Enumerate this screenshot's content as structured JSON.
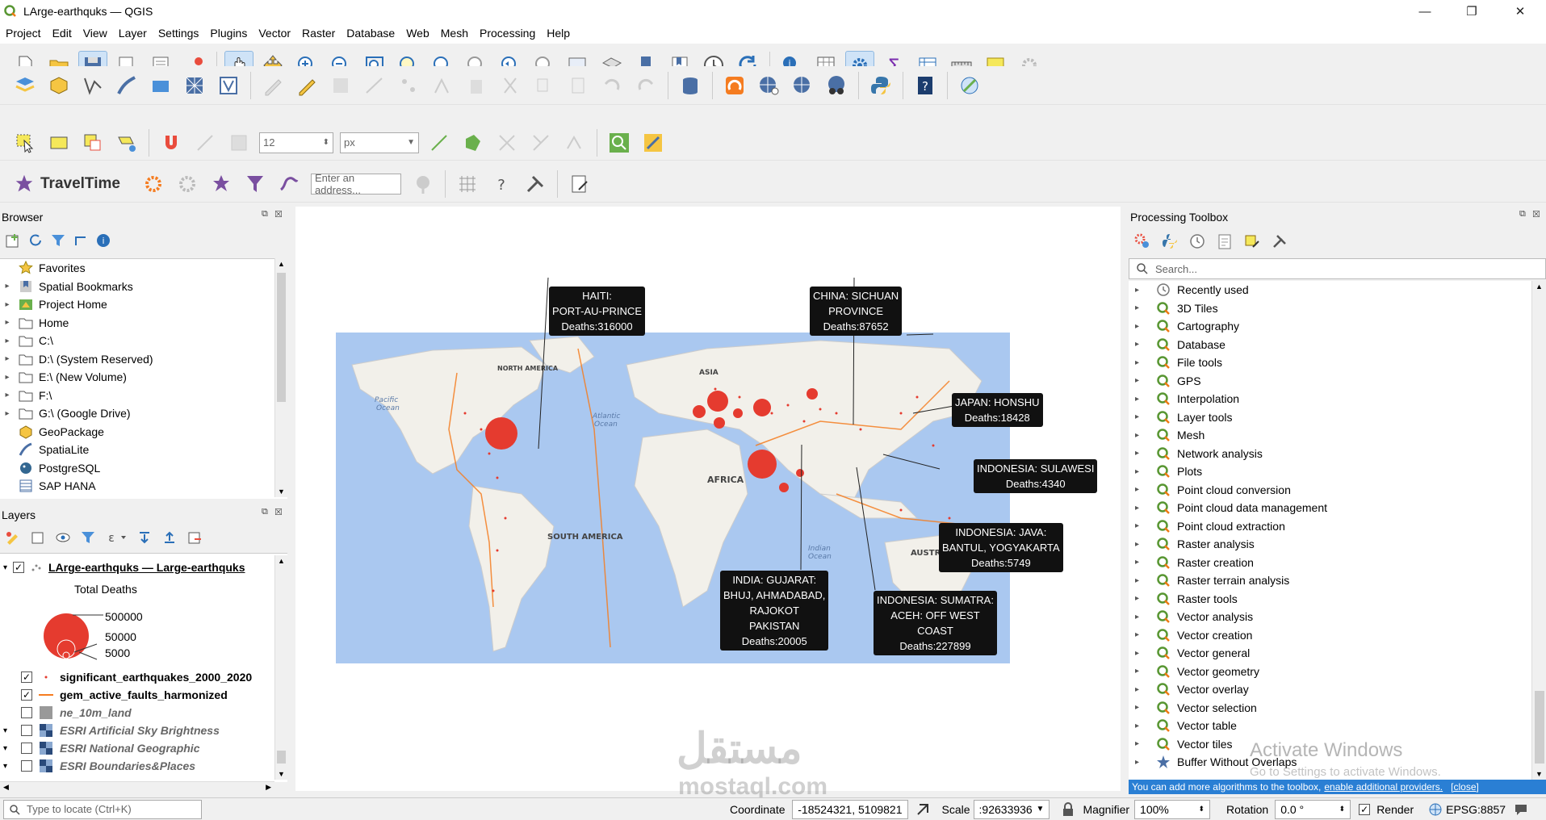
{
  "window": {
    "title": "LArge-earthquks — QGIS",
    "controls": [
      "—",
      "❐",
      "✕"
    ]
  },
  "menu": [
    "Project",
    "Edit",
    "View",
    "Layer",
    "Settings",
    "Plugins",
    "Vector",
    "Raster",
    "Database",
    "Web",
    "Mesh",
    "Processing",
    "Help"
  ],
  "toolbar3": {
    "size_value": "12",
    "unit_value": "px"
  },
  "toolbar4": {
    "traveltime_label": "TravelTime",
    "address_placeholder": "Enter an address..."
  },
  "browser": {
    "title": "Browser",
    "items": [
      {
        "label": "Favorites",
        "icon": "star-icon"
      },
      {
        "label": "Spatial Bookmarks",
        "icon": "bookmark-icon"
      },
      {
        "label": "Project Home",
        "icon": "project-home-icon"
      },
      {
        "label": "Home",
        "icon": "folder-icon"
      },
      {
        "label": "C:\\",
        "icon": "folder-icon"
      },
      {
        "label": "D:\\ (System Reserved)",
        "icon": "folder-icon"
      },
      {
        "label": "E:\\ (New Volume)",
        "icon": "folder-icon"
      },
      {
        "label": "F:\\",
        "icon": "folder-icon"
      },
      {
        "label": "G:\\ (Google Drive)",
        "icon": "folder-icon"
      },
      {
        "label": "GeoPackage",
        "icon": "geopackage-icon"
      },
      {
        "label": "SpatiaLite",
        "icon": "spatialite-icon"
      },
      {
        "label": "PostgreSQL",
        "icon": "postgresql-icon"
      },
      {
        "label": "SAP HANA",
        "icon": "sap-hana-icon"
      }
    ]
  },
  "layers": {
    "title": "Layers",
    "main_layer": "LArge-earthquks — Large-earthquks",
    "legend_title": "Total Deaths",
    "legend_values": [
      "500000",
      "50000",
      "5000"
    ],
    "items": [
      {
        "label": "significant_earthquakes_2000_2020",
        "checked": true,
        "bold": true
      },
      {
        "label": "gem_active_faults_harmonized",
        "checked": true,
        "bold": true
      },
      {
        "label": "ne_10m_land",
        "checked": false,
        "bold": false
      },
      {
        "label": "ESRI Artificial Sky Brightness",
        "checked": false,
        "bold": false
      },
      {
        "label": "ESRI National Geographic",
        "checked": false,
        "bold": false
      },
      {
        "label": "ESRI Boundaries&Places",
        "checked": false,
        "bold": false
      }
    ]
  },
  "map": {
    "ocean_color": "#aac8f0",
    "land_color": "#f2f0ea",
    "labels": {
      "north_america": "NORTH AMERICA",
      "south_america": "SOUTH AMERICA",
      "africa": "AFRICA",
      "asia": "ASIA",
      "australia": "AUSTRA",
      "pacific": "Pacific\nOcean",
      "atlantic": "Atlantic\nOcean",
      "indian": "Indian\nOcean"
    },
    "callouts": [
      {
        "lines": [
          "HAITI:",
          "PORT-AU-PRINCE",
          "Deaths:316000"
        ]
      },
      {
        "lines": [
          "CHINA:  SICHUAN",
          "PROVINCE",
          "Deaths:87652"
        ]
      },
      {
        "lines": [
          "JAPAN:  HONSHU",
          "Deaths:18428"
        ]
      },
      {
        "lines": [
          "INDONESIA:  SULAWESI",
          "Deaths:4340"
        ]
      },
      {
        "lines": [
          "INDONESIA:  JAVA:",
          "BANTUL, YOGYAKARTA",
          "Deaths:5749"
        ]
      },
      {
        "lines": [
          "INDIA:  GUJARAT:",
          "BHUJ, AHMADABAD,",
          "RAJOKOT",
          "PAKISTAN",
          "Deaths:20005"
        ]
      },
      {
        "lines": [
          "INDONESIA:  SUMATRA:",
          "ACEH:  OFF WEST",
          "COAST",
          "Deaths:227899"
        ]
      }
    ]
  },
  "processing": {
    "title": "Processing Toolbox",
    "search_placeholder": "Search...",
    "items": [
      "Recently used",
      "3D Tiles",
      "Cartography",
      "Database",
      "File tools",
      "GPS",
      "Interpolation",
      "Layer tools",
      "Mesh",
      "Network analysis",
      "Plots",
      "Point cloud conversion",
      "Point cloud data management",
      "Point cloud extraction",
      "Raster analysis",
      "Raster creation",
      "Raster terrain analysis",
      "Raster tools",
      "Vector analysis",
      "Vector creation",
      "Vector general",
      "Vector geometry",
      "Vector overlay",
      "Vector selection",
      "Vector table",
      "Vector tiles",
      "Buffer Without Overlaps"
    ],
    "info_text": "You can add more algorithms to the toolbox,",
    "info_link": "enable additional providers.",
    "info_close": "[close]"
  },
  "watermark": {
    "text": "mostaql.com",
    "arabic": "مستقل",
    "activate_title": "Activate Windows",
    "activate_sub": "Go to Settings to activate Windows."
  },
  "status": {
    "locate_placeholder": "Type to locate (Ctrl+K)",
    "coordinate_label": "Coordinate",
    "coordinate_value": "-18524321, 5109821",
    "scale_label": "Scale",
    "scale_value": ":92633936",
    "magnifier_label": "Magnifier",
    "magnifier_value": "100%",
    "rotation_label": "Rotation",
    "rotation_value": "0.0 °",
    "render_label": "Render",
    "crs": "EPSG:8857"
  }
}
